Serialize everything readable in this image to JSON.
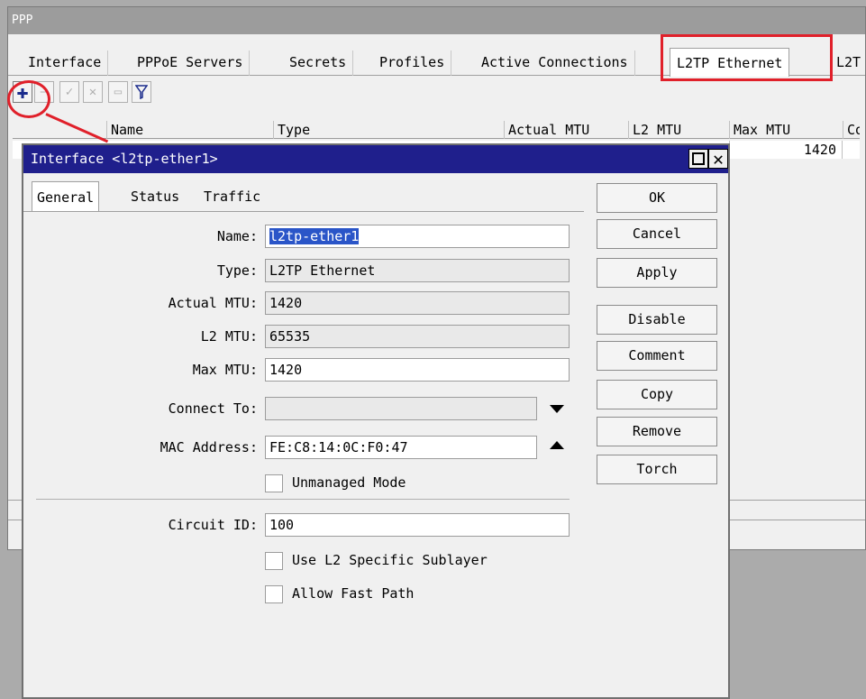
{
  "ppp": {
    "title": "PPP",
    "tabs": [
      "Interface",
      "PPPoE Servers",
      "Secrets",
      "Profiles",
      "Active Connections",
      "L2TP Ethernet",
      "L2T"
    ],
    "columns": [
      "Name",
      "Type",
      "Actual MTU",
      "L2 MTU",
      "Max MTU",
      "Con"
    ],
    "row": {
      "max_mtu": "1420"
    }
  },
  "dialog": {
    "title": "Interface <l2tp-ether1>",
    "tabs": [
      "General",
      "Status",
      "Traffic"
    ],
    "fields": {
      "name_label": "Name:",
      "name_value": "l2tp-ether1",
      "type_label": "Type:",
      "type_value": "L2TP Ethernet",
      "actual_mtu_label": "Actual MTU:",
      "actual_mtu_value": "1420",
      "l2_mtu_label": "L2 MTU:",
      "l2_mtu_value": "65535",
      "max_mtu_label": "Max MTU:",
      "max_mtu_value": "1420",
      "connect_to_label": "Connect To:",
      "connect_to_value": "",
      "mac_label": "MAC Address:",
      "mac_value": "FE:C8:14:0C:F0:47",
      "unmanaged_label": "Unmanaged Mode",
      "circuit_label": "Circuit ID:",
      "circuit_value": "100",
      "l2_sublayer_label": "Use L2 Specific Sublayer",
      "fast_path_label": "Allow Fast Path"
    },
    "buttons": [
      "OK",
      "Cancel",
      "Apply",
      "Disable",
      "Comment",
      "Copy",
      "Remove",
      "Torch"
    ]
  },
  "colors": {
    "highlight": "#e0202a",
    "dialog_title": "#1f1f8c",
    "selection": "#2a55c8"
  }
}
